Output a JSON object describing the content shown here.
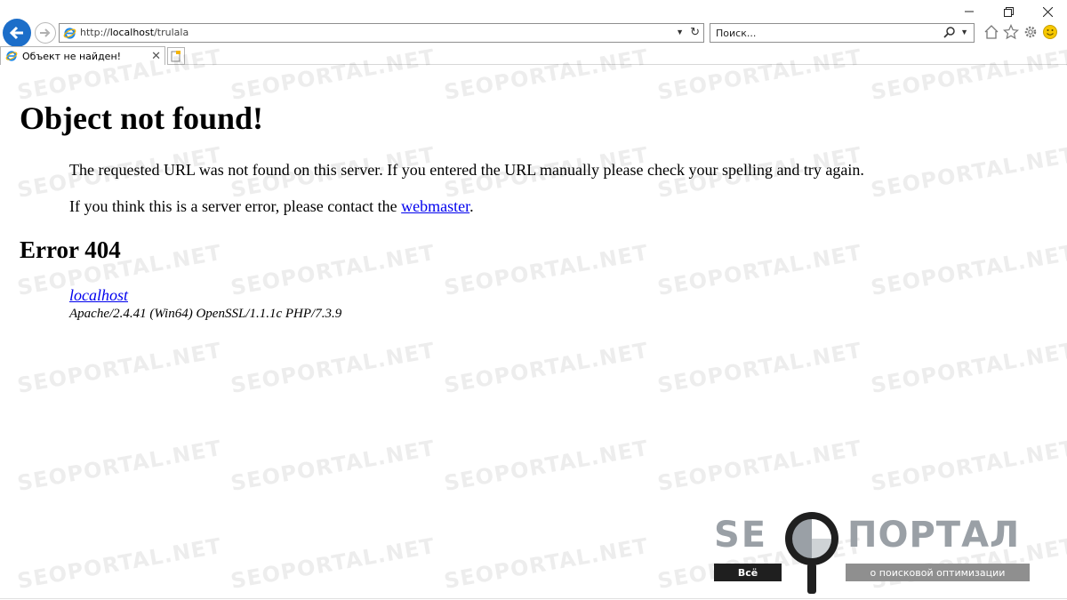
{
  "browser": {
    "address_url_prefix": "http://",
    "address_url_host": "localhost",
    "address_url_path": "/trulala",
    "search_placeholder": "Поиск...",
    "tab_title": "Объект не найден!",
    "accent_color": "#1c6ec9"
  },
  "page": {
    "heading": "Object not found!",
    "paragraph1": "The requested URL was not found on this server. If you entered the URL manually please check your spelling and try again.",
    "paragraph2_before": "If you think this is a server error, please contact the ",
    "webmaster_link": "webmaster",
    "paragraph2_after": ".",
    "error_heading": "Error 404",
    "host_link": "localhost",
    "server_signature": "Apache/2.4.41 (Win64) OpenSSL/1.1.1c PHP/7.3.9",
    "link_color": "#0000ee"
  },
  "watermark": {
    "text": "SEOPORTAL.NET"
  },
  "logo": {
    "left_text": "SE",
    "right_text": "ПОРТАЛ",
    "left_sub": "Всё",
    "right_sub": "о поисковой оптимизации"
  },
  "icons": [
    "back-arrow-icon",
    "forward-arrow-icon",
    "ie-logo-icon",
    "dropdown-icon",
    "refresh-icon",
    "search-icon",
    "home-icon",
    "favorites-star-icon",
    "settings-gear-icon",
    "feedback-smiley-icon",
    "minimize-icon",
    "restore-icon",
    "close-icon",
    "new-tab-icon",
    "tab-close-icon"
  ]
}
